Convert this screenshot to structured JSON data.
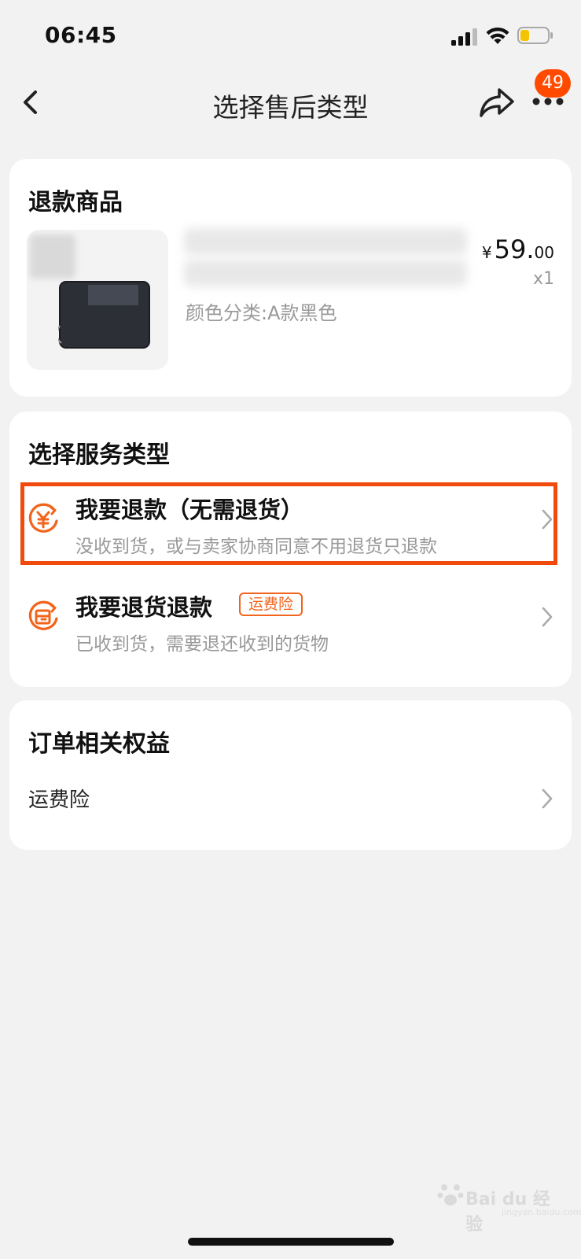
{
  "status_bar": {
    "time": "06:45"
  },
  "nav": {
    "title": "选择售后类型",
    "badge_count": "49"
  },
  "product_card": {
    "title": "退款商品",
    "price_currency": "¥",
    "price_integer": "59.",
    "price_decimal": "00",
    "quantity": "x1",
    "variant": "颜色分类:A款黑色"
  },
  "service_card": {
    "title": "选择服务类型",
    "options": [
      {
        "title": "我要退款（无需退货）",
        "desc": "没收到货，或与卖家协商同意不用退货只退款",
        "highlighted": true
      },
      {
        "title": "我要退货退款",
        "tag": "运费险",
        "desc": "已收到货，需要退还收到的货物"
      }
    ]
  },
  "benefits_card": {
    "title": "订单相关权益",
    "items": [
      {
        "label": "运费险"
      }
    ]
  },
  "watermark": {
    "text": "Bai du 经验",
    "sub": "jingyan.baidu.com"
  },
  "colors": {
    "accent": "#f04a0c",
    "badge": "#ff4a00",
    "icon_orange": "#f2641b"
  }
}
